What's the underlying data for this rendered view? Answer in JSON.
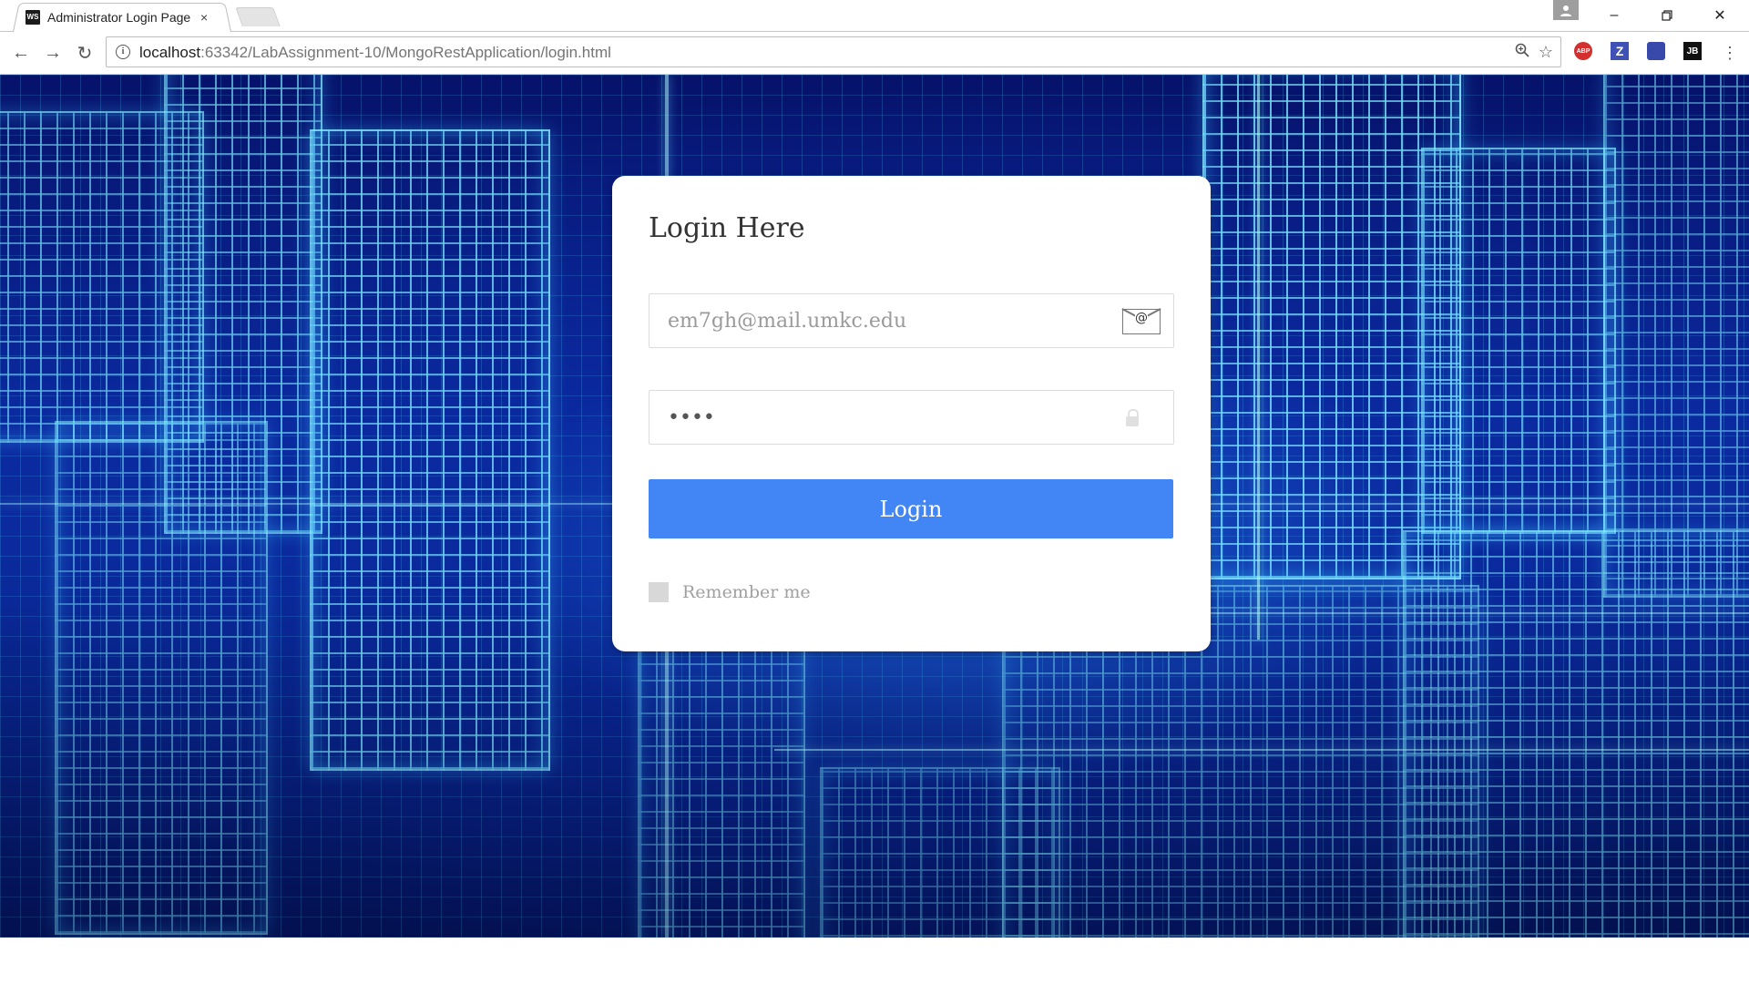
{
  "browser": {
    "tab_title": "Administrator Login Page",
    "tab_favicon": "WS",
    "url_host": "localhost",
    "url_rest": ":63342/LabAssignment-10/MongoRestApplication/login.html",
    "extensions": [
      {
        "name": "adblock-plus-icon",
        "label": "ABP",
        "color": "#d32f2f"
      },
      {
        "name": "zotero-icon",
        "label": "Z",
        "color": "#3f51b5"
      },
      {
        "name": "extension-icon",
        "label": "",
        "color": "#3949ab"
      },
      {
        "name": "jetbrains-icon",
        "label": "JB",
        "color": "#111111"
      }
    ]
  },
  "login": {
    "title": "Login Here",
    "email_placeholder": "em7gh@mail.umkc.edu",
    "password_value": "••••",
    "button_label": "Login",
    "remember_label": "Remember me"
  },
  "colors": {
    "button": "#4285f4",
    "card": "#ffffff",
    "background_dark": "#06126a",
    "glow": "#5adcff"
  }
}
